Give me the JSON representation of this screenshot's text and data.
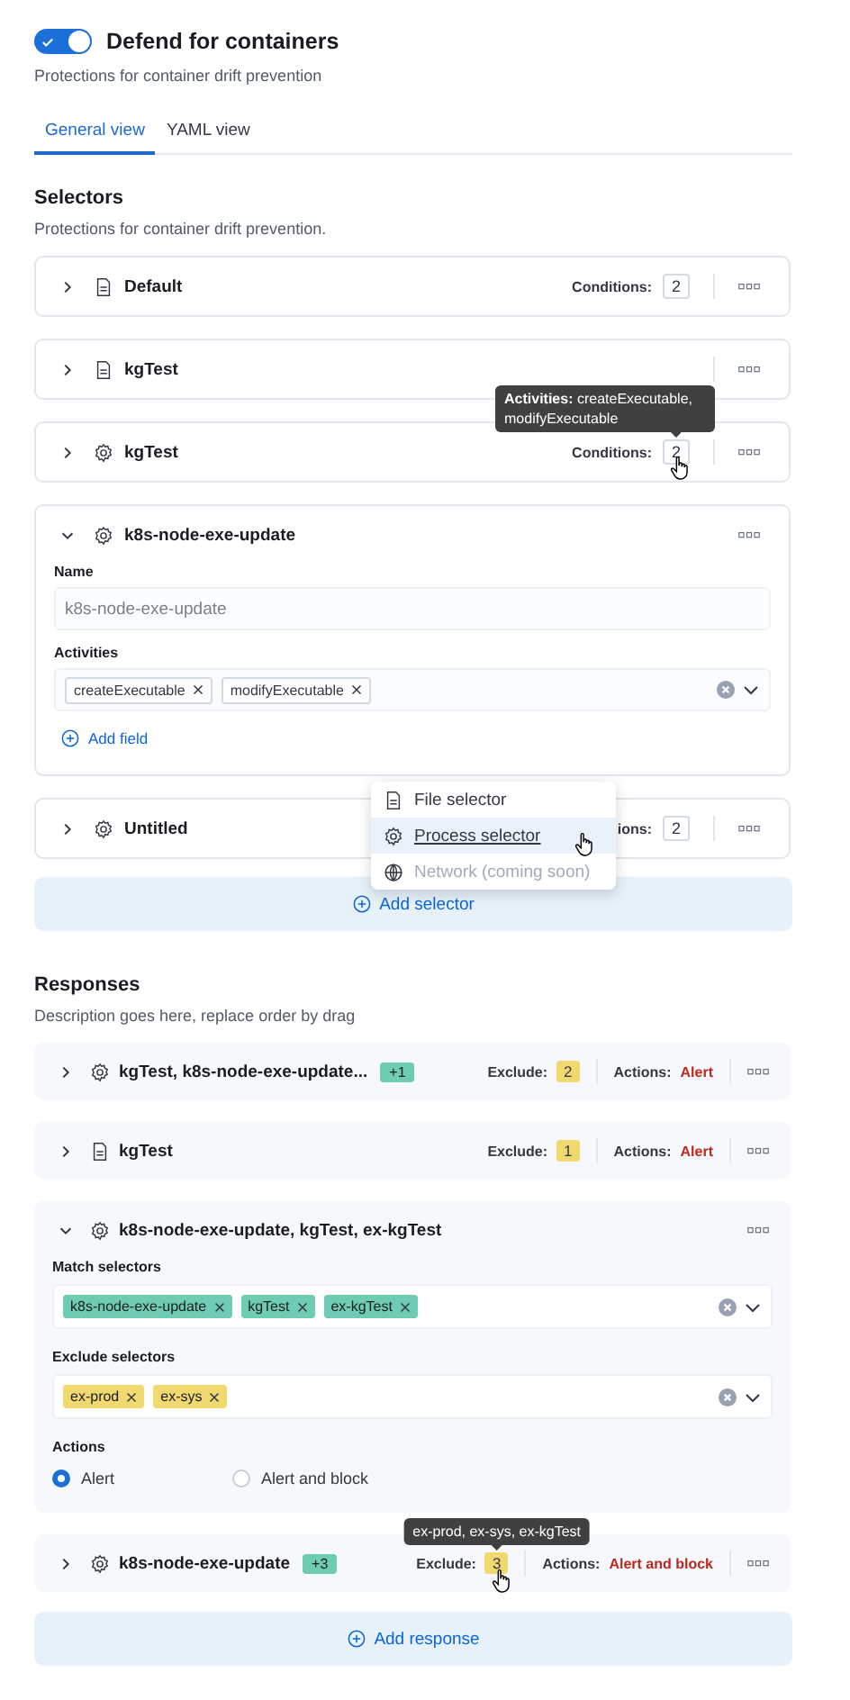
{
  "header": {
    "toggle_on": true,
    "title": "Defend for containers",
    "subtitle": "Protections for container drift prevention"
  },
  "tabs": [
    {
      "label": "General view",
      "selected": true
    },
    {
      "label": "YAML view",
      "selected": false
    }
  ],
  "selectors": {
    "title": "Selectors",
    "description": "Protections for container drift prevention.",
    "items": [
      {
        "name": "Default",
        "kind": "file",
        "expanded": false,
        "conditions_label": "Conditions:",
        "conditions": "2"
      },
      {
        "name": "kgTest",
        "kind": "file",
        "expanded": false
      },
      {
        "name": "kgTest",
        "kind": "gear",
        "expanded": false,
        "conditions_label": "Conditions:",
        "conditions": "2",
        "tooltip_label": "Activities:",
        "tooltip": "createExecutable, modifyExecutable"
      },
      {
        "name": "k8s-node-exe-update",
        "kind": "gear",
        "expanded": true,
        "name_label": "Name",
        "name_value": "k8s-node-exe-update",
        "activities_label": "Activities",
        "activities": [
          "createExecutable",
          "modifyExecutable"
        ],
        "add_field": "Add field"
      },
      {
        "name": "Untitled",
        "kind": "gear",
        "expanded": false,
        "conditions_label": "ions:",
        "conditions": "2"
      }
    ],
    "add_menu": [
      {
        "label": "File selector",
        "kind": "file",
        "selected": false,
        "disabled": false
      },
      {
        "label": "Process selector",
        "kind": "gear",
        "selected": true,
        "disabled": false
      },
      {
        "label": "Network (coming soon)",
        "kind": "globe",
        "selected": false,
        "disabled": true
      }
    ],
    "add_button": "Add selector"
  },
  "responses": {
    "title": "Responses",
    "description": "Description goes here, replace order by drag",
    "items": [
      {
        "name": "kgTest, k8s-node-exe-update...",
        "kind": "gear",
        "expanded": false,
        "more": "+1",
        "exclude_label": "Exclude:",
        "exclude": "2",
        "actions_label": "Actions:",
        "actions": "Alert"
      },
      {
        "name": "kgTest",
        "kind": "file",
        "expanded": false,
        "exclude_label": "Exclude:",
        "exclude": "1",
        "actions_label": "Actions:",
        "actions": "Alert"
      },
      {
        "name": "k8s-node-exe-update, kgTest, ex-kgTest",
        "kind": "gear",
        "expanded": true,
        "match_label": "Match selectors",
        "match": [
          "k8s-node-exe-update",
          "kgTest",
          "ex-kgTest"
        ],
        "exclude_selectors_label": "Exclude selectors",
        "exclude_tags": [
          "ex-prod",
          "ex-sys"
        ],
        "actions_label": "Actions",
        "options": [
          {
            "label": "Alert",
            "selected": true
          },
          {
            "label": "Alert and block",
            "selected": false
          }
        ]
      },
      {
        "name": "k8s-node-exe-update",
        "kind": "gear",
        "expanded": false,
        "more": "+3",
        "exclude_label": "Exclude:",
        "exclude": "3",
        "actions_label": "Actions:",
        "actions": "Alert and block",
        "tooltip": "ex-prod, ex-sys, ex-kgTest"
      }
    ],
    "add_button": "Add response"
  }
}
